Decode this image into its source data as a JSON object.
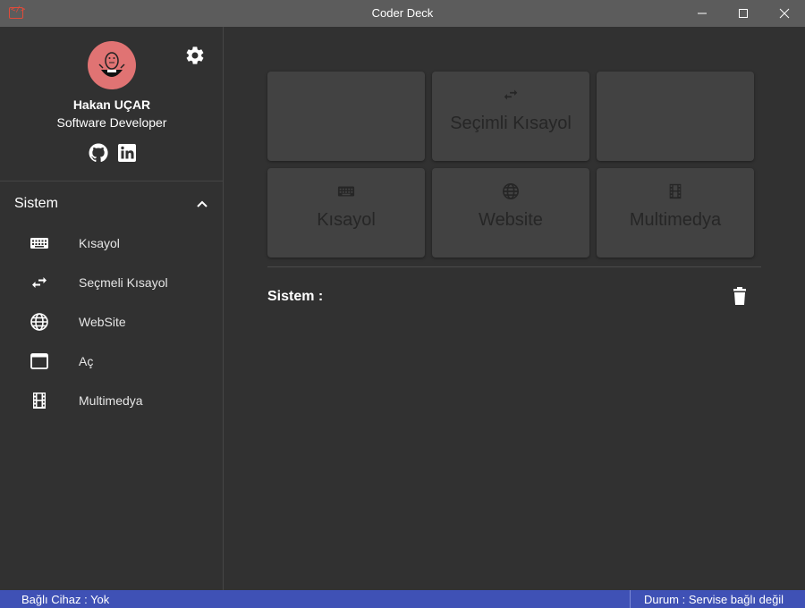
{
  "window": {
    "title": "Coder Deck",
    "app_icon_glyph": "</>"
  },
  "profile": {
    "name": "Hakan UÇAR",
    "role": "Software Developer"
  },
  "sidebar": {
    "section_title": "Sistem",
    "items": [
      {
        "label": "Kısayol",
        "icon": "keyboard-icon"
      },
      {
        "label": "Seçmeli Kısayol",
        "icon": "swap-icon"
      },
      {
        "label": "WebSite",
        "icon": "globe-icon"
      },
      {
        "label": "Aç",
        "icon": "window-icon"
      },
      {
        "label": "Multimedya",
        "icon": "film-icon"
      }
    ]
  },
  "main": {
    "tiles": [
      {
        "label": "",
        "icon": ""
      },
      {
        "label": "Seçimli Kısayol",
        "icon": "swap-icon"
      },
      {
        "label": "",
        "icon": ""
      },
      {
        "label": "Kısayol",
        "icon": "keyboard-icon"
      },
      {
        "label": "Website",
        "icon": "globe-icon"
      },
      {
        "label": "Multimedya",
        "icon": "film-icon"
      }
    ],
    "section_label": "Sistem :"
  },
  "status": {
    "device": "Bağlı Cihaz : Yok",
    "state": "Durum : Servise bağlı değil"
  },
  "colors": {
    "titlebar": "#5c5c5c",
    "background": "#313131",
    "tile": "#424242",
    "statusbar": "#3f51b5",
    "avatar": "#e07373",
    "app_icon": "#e04b3a"
  }
}
